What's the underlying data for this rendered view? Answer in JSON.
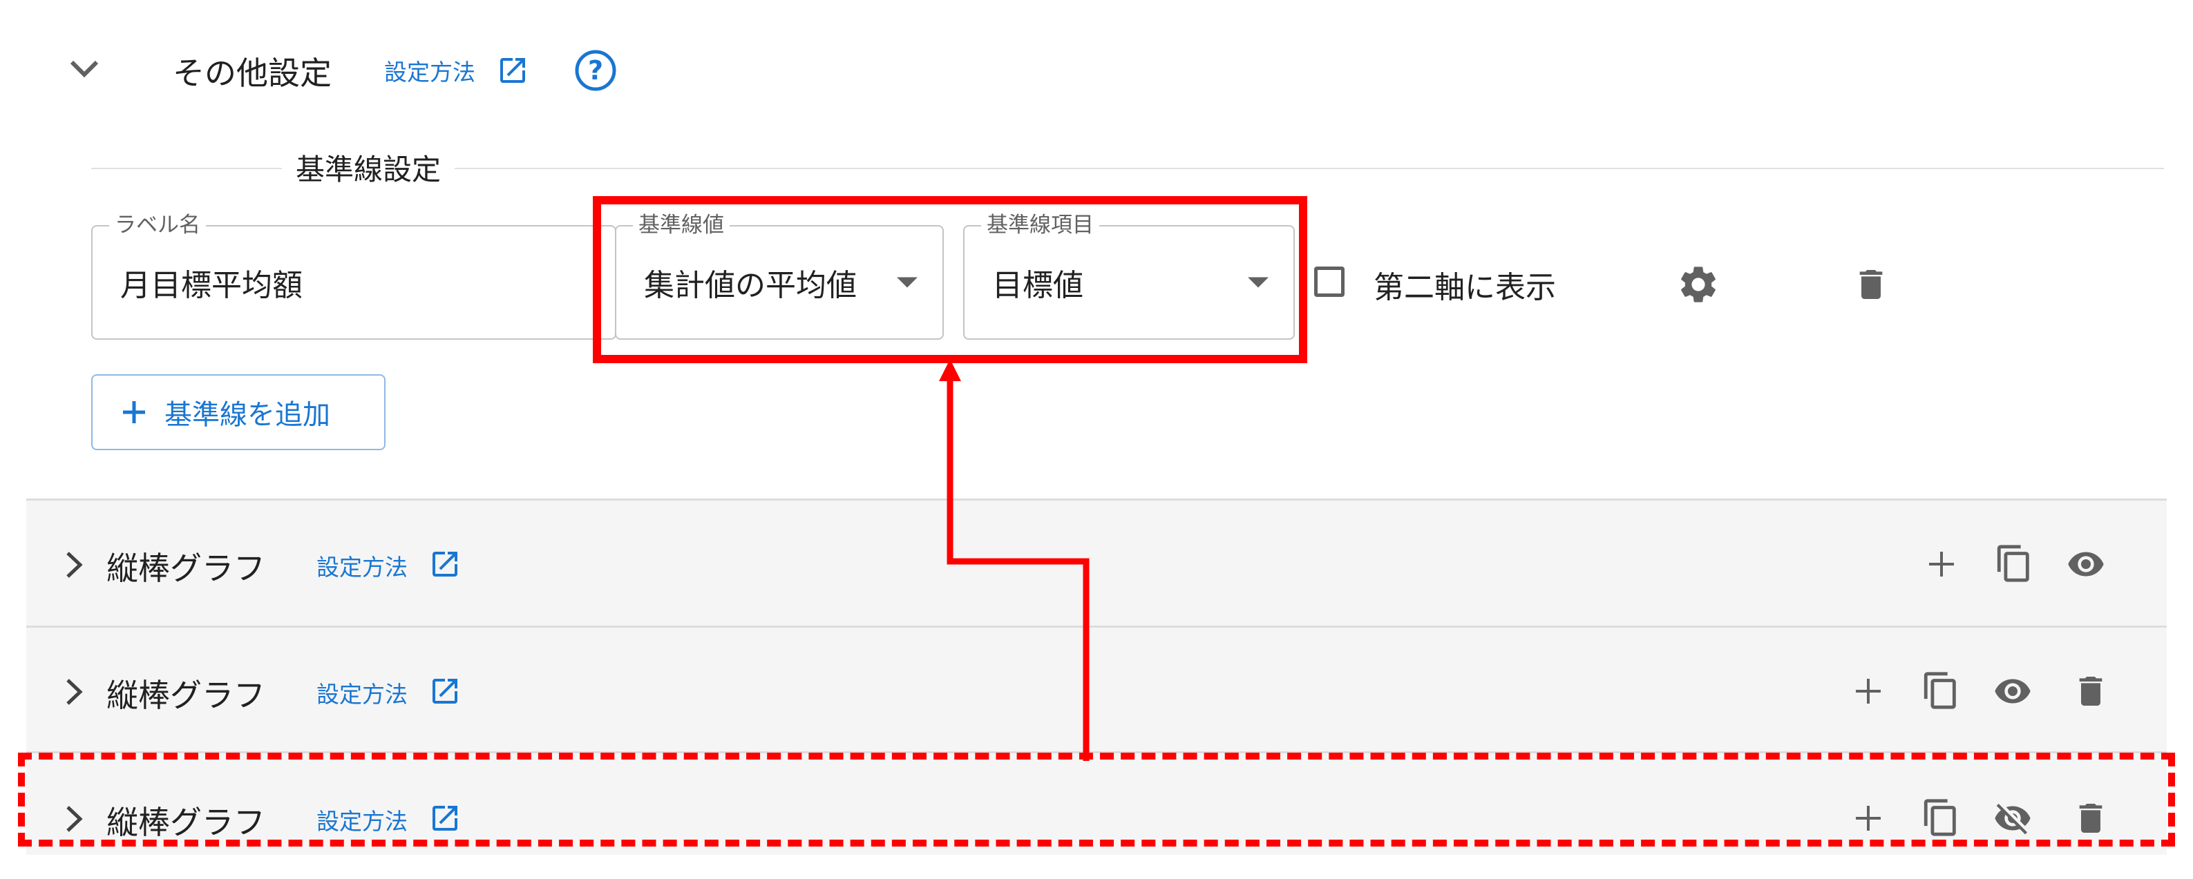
{
  "header": {
    "title": "その他設定",
    "howto_label": "設定方法"
  },
  "baseline_section": {
    "legend": "基準線設定",
    "label_field": {
      "label": "ラベル名",
      "value": "月目標平均額"
    },
    "value_field": {
      "label": "基準線値",
      "value": "集計値の平均値"
    },
    "item_field": {
      "label": "基準線項目",
      "value": "目標値"
    },
    "second_axis_label": "第二軸に表示",
    "add_button_label": "基準線を追加"
  },
  "chart_rows": [
    {
      "title": "縦棒グラフ",
      "howto_label": "設定方法",
      "visible": true,
      "deletable": false
    },
    {
      "title": "縦棒グラフ",
      "howto_label": "設定方法",
      "visible": true,
      "deletable": true
    },
    {
      "title": "縦棒グラフ",
      "howto_label": "設定方法",
      "visible": false,
      "deletable": true
    }
  ],
  "colors": {
    "accent": "#1976d2",
    "annotation": "#ff0000",
    "row_bg": "#f5f5f5"
  }
}
